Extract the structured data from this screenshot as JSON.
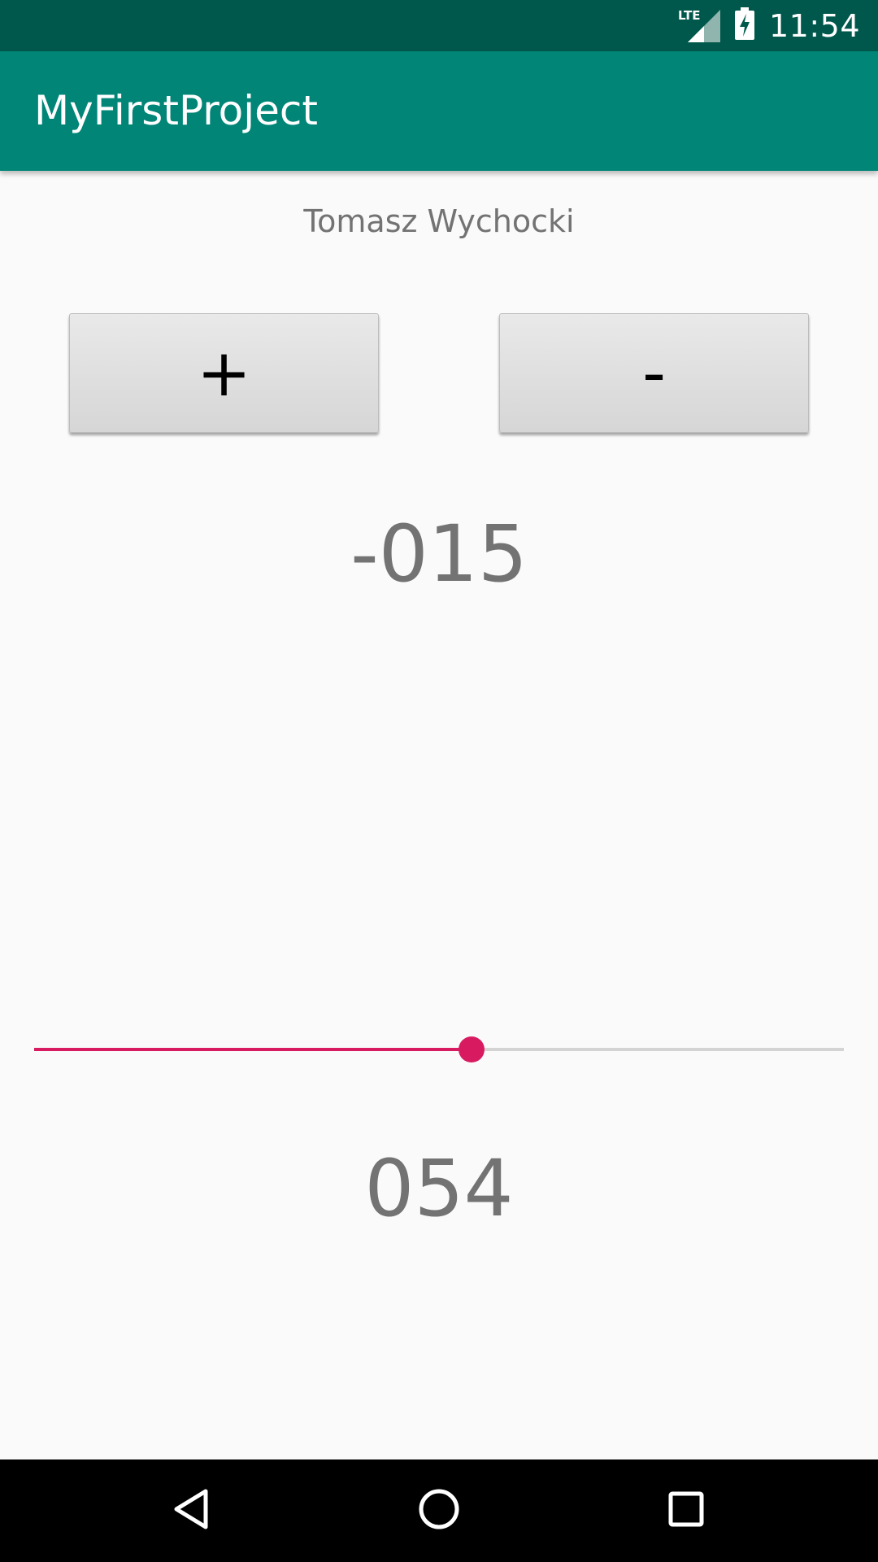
{
  "status_bar": {
    "network": "LTE",
    "time": "11:54"
  },
  "app_bar": {
    "title": "MyFirstProject"
  },
  "content": {
    "author": "Tomasz Wychocki",
    "plus_label": "+",
    "minus_label": "-",
    "counter": "-015",
    "slider": {
      "percent": 54,
      "value_display": "054",
      "active_color": "#d81b60",
      "track_color": "#d4d4d4"
    }
  },
  "nav_bar": {
    "icons": [
      "back-icon",
      "home-icon",
      "recents-icon"
    ]
  },
  "colors": {
    "status_bar": "#00574b",
    "app_bar": "#008577",
    "accent": "#d81b60"
  }
}
